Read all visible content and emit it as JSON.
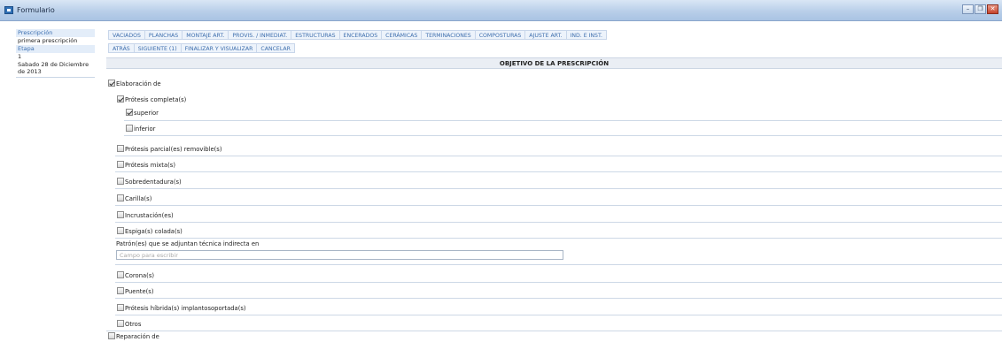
{
  "window": {
    "title": "Formulario"
  },
  "sidebar": {
    "prescription_label": "Prescripción",
    "prescription_value": "primera prescripción",
    "stage_label": "Etapa",
    "stage_value": "1",
    "date": "Sabado 28 de Diciembre de 2013"
  },
  "tabs": [
    "VACIADOS",
    "PLANCHAS",
    "MONTAJE ART.",
    "PROVIS. / INMEDIAT.",
    "ESTRUCTURAS",
    "ENCERADOS",
    "CERÁMICAS",
    "TERMINACIONES",
    "COMPOSTURAS",
    "AJUSTE ART.",
    "IND. E INST."
  ],
  "nav": [
    "ATRÁS",
    "SIGUIENTE (1)",
    "FINALIZAR Y VISUALIZAR",
    "CANCELAR"
  ],
  "section": {
    "title": "OBJETIVO DE LA PRESCRIPCIÓN"
  },
  "form": {
    "elaboracion": "Elaboración de",
    "protesis_completa": "Prótesis completa(s)",
    "superior": "superior",
    "inferior": "inferior",
    "parcial_removible": "Prótesis parcial(es) removible(s)",
    "mixta": "Prótesis mixta(s)",
    "sobredentadura": "Sobredentadura(s)",
    "carilla": "Carilla(s)",
    "incrustacion": "Incrustación(es)",
    "espiga_colada": "Espiga(s) colada(s)",
    "patron_label": "Patrón(es) que se adjuntan técnica indirecta en",
    "patron_placeholder": "Campo para escribir",
    "corona": "Corona(s)",
    "puente": "Puente(s)",
    "hibrida": "Prótesis híbrida(s) implantosoportada(s)",
    "otros": "Otros",
    "reparacion": "Reparación de"
  }
}
